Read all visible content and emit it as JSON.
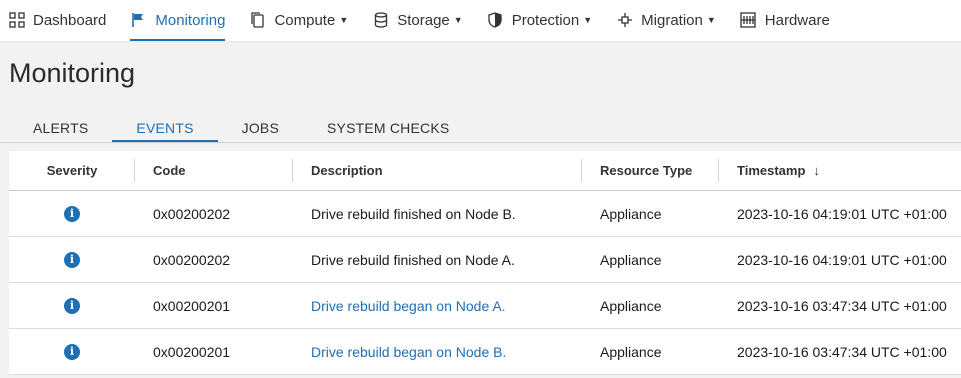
{
  "nav": {
    "items": [
      {
        "label": "Dashboard",
        "icon": "grid-icon"
      },
      {
        "label": "Monitoring",
        "icon": "flag-icon"
      },
      {
        "label": "Compute",
        "icon": "copy-icon"
      },
      {
        "label": "Storage",
        "icon": "database-icon"
      },
      {
        "label": "Protection",
        "icon": "shield-icon"
      },
      {
        "label": "Migration",
        "icon": "migration-icon"
      },
      {
        "label": "Hardware",
        "icon": "hardware-icon"
      }
    ],
    "active": "Monitoring"
  },
  "page": {
    "title": "Monitoring"
  },
  "tabs": {
    "items": [
      "ALERTS",
      "EVENTS",
      "JOBS",
      "SYSTEM CHECKS"
    ],
    "active": "EVENTS"
  },
  "table": {
    "columns": {
      "severity": "Severity",
      "code": "Code",
      "description": "Description",
      "resource_type": "Resource Type",
      "timestamp": "Timestamp"
    },
    "sort_arrow": "↓",
    "rows": [
      {
        "severity_icon": "info-icon",
        "code": "0x00200202",
        "description": "Drive rebuild finished on Node B.",
        "resource_type": "Appliance",
        "timestamp": "2023-10-16 04:19:01 UTC +01:00"
      },
      {
        "severity_icon": "info-icon",
        "code": "0x00200202",
        "description": "Drive rebuild finished on Node A.",
        "resource_type": "Appliance",
        "timestamp": "2023-10-16 04:19:01 UTC +01:00"
      },
      {
        "severity_icon": "info-icon",
        "code": "0x00200201",
        "description": "Drive rebuild began on Node A.",
        "resource_type": "Appliance",
        "timestamp": "2023-10-16 03:47:34 UTC +01:00"
      },
      {
        "severity_icon": "info-icon",
        "code": "0x00200201",
        "description": "Drive rebuild began on Node B.",
        "resource_type": "Appliance",
        "timestamp": "2023-10-16 03:47:34 UTC +01:00"
      }
    ]
  },
  "colors": {
    "accent": "#1f6fb5",
    "background": "#f2f2f2"
  }
}
